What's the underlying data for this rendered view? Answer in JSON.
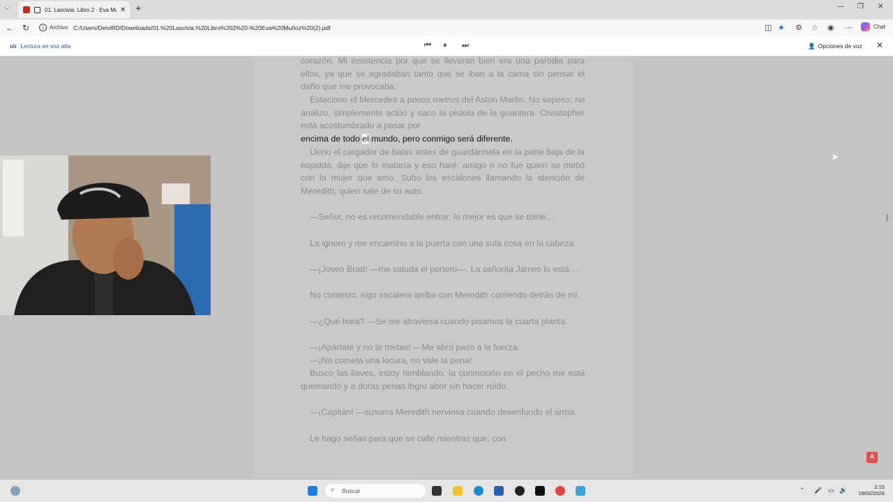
{
  "browser": {
    "tab_title": "01. Lascivia. Libro 2 - Eva Muñ",
    "address_label": "Archivo",
    "url": "C:/Users/DeiviRD/Downloads/01.%20Lascivia.%20Libro%202%20-%20Eva%20Muñoz%20(2).pdf",
    "chat_label": "Chat"
  },
  "read_aloud": {
    "label": "Lectura en voz alta",
    "voice_options_label": "Opciones de voz"
  },
  "document": {
    "paragraphs": [
      "corazón. Mi insistencia por que se llevaran bien era una parodia para ellos, ya que se agradaban tanto que se iban a la cama sin pensar el daño que me provocaba.",
      "Estaciono el Mercedes a pocos metros del Aston Martin. No sopeso, no analizo, simplemente actúo y saco la pistola de la guantera. Christopher está acostumbrado a pasar por",
      "Lleno el cargador de balas antes de guardármela en la parte baja de la espalda, dije que lo mataría y eso haré: amigo o no fue quien se metió con la mujer que amo. Subo los escalones llamando la atención de Meredith, quien sale de su auto.",
      "—Señor, no es recomendable entrar, lo mejor es que se tome…",
      "La ignoro y me encamino a la puerta con una sola cosa en la cabeza.",
      "—¡Joven Bratt! —me saluda el portero—. La señorita James lo está…",
      "No contesto, sigo escalera arriba con Meredith corriendo detrás de mí.",
      "—¿Qué hará? —Se me atraviesa cuando pisamos la cuarta planta.",
      "—¡Apártate y no te metas! —Me abro paso a la fuerza.",
      "—¡No cometa una locura, no vale la pena!",
      "Busco las llaves, estoy temblando, la conmoción en el pecho me está quemando y a duras penas logro abrir sin hacer ruido.",
      "—¡Capitán! —susurra Meredith nerviosa cuando desenfundo el arma.",
      "Le hago señas para que se calle mientras que, con"
    ],
    "active_line_before": "encima de todo ",
    "active_word": "el",
    "active_line_after": " mundo, pero conmigo será diferente."
  },
  "taskbar": {
    "search_placeholder": "Buscar",
    "time": "2:15",
    "date": "19/02/2026"
  },
  "colors": {
    "accent": "#2b579a",
    "page_bg": "#c9c9c9"
  }
}
